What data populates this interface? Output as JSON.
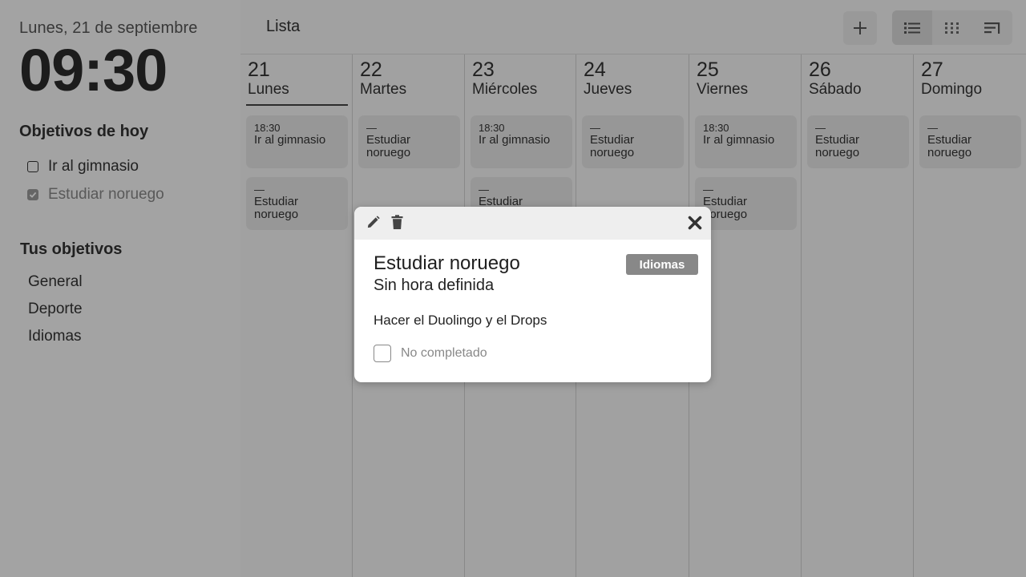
{
  "sidebar": {
    "date": "Lunes, 21 de septiembre",
    "clock": "09:30",
    "today_title": "Objetivos de hoy",
    "today_items": [
      {
        "label": "Ir al gimnasio",
        "checked": false
      },
      {
        "label": "Estudiar noruego",
        "checked": true
      }
    ],
    "goals_title": "Tus objetivos",
    "goals": [
      "General",
      "Deporte",
      "Idiomas"
    ]
  },
  "header": {
    "title": "Lista",
    "add_icon": "plus-icon",
    "views": [
      {
        "icon": "list-view-icon",
        "active": true
      },
      {
        "icon": "grid-view-icon",
        "active": false
      },
      {
        "icon": "timeline-view-icon",
        "active": false
      }
    ]
  },
  "week": {
    "days": [
      {
        "num": "21",
        "name": "Lunes",
        "cards": [
          {
            "time": "18:30",
            "title": "Ir al gimnasio"
          },
          {
            "time": "—",
            "title": "Estudiar noruego"
          }
        ]
      },
      {
        "num": "22",
        "name": "Martes",
        "cards": [
          {
            "time": "—",
            "title": "Estudiar noruego"
          }
        ]
      },
      {
        "num": "23",
        "name": "Miércoles",
        "cards": [
          {
            "time": "18:30",
            "title": "Ir al gimnasio"
          },
          {
            "time": "—",
            "title": "Estudiar noruego"
          }
        ]
      },
      {
        "num": "24",
        "name": "Jueves",
        "cards": [
          {
            "time": "—",
            "title": "Estudiar noruego"
          }
        ]
      },
      {
        "num": "25",
        "name": "Viernes",
        "cards": [
          {
            "time": "18:30",
            "title": "Ir al gimnasio"
          },
          {
            "time": "—",
            "title": "Estudiar noruego"
          }
        ]
      },
      {
        "num": "26",
        "name": "Sábado",
        "cards": [
          {
            "time": "—",
            "title": "Estudiar noruego"
          }
        ]
      },
      {
        "num": "27",
        "name": "Domingo",
        "cards": [
          {
            "time": "—",
            "title": "Estudiar noruego"
          }
        ]
      }
    ],
    "current_day": "21"
  },
  "modal": {
    "title": "Estudiar noruego",
    "subtitle": "Sin hora definida",
    "tag": "Idiomas",
    "description": "Hacer el Duolingo y el Drops",
    "status_label": "No completado",
    "edit_icon": "pencil-icon",
    "delete_icon": "trash-icon",
    "close_icon": "close-icon"
  },
  "colors": {
    "overlay": "#00000057",
    "tag": "#888888",
    "card": "#e6e6e6"
  }
}
